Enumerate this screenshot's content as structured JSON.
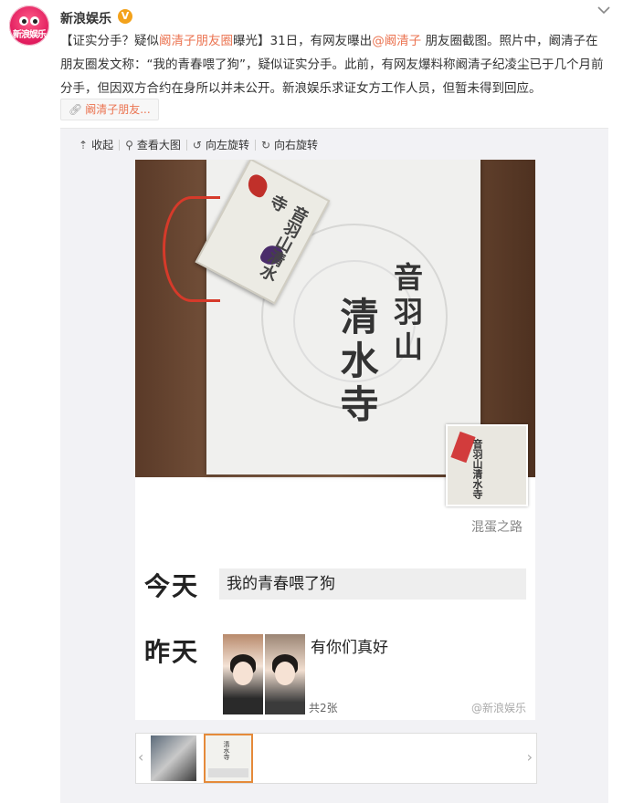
{
  "account": {
    "avatar_text": "新浪娱乐",
    "name": "新浪娱乐",
    "verified_badge": "V",
    "menu_icon": "chevron-down-icon"
  },
  "post": {
    "p1": "【证实分手？疑似",
    "p1_link": "阚清子朋友圈",
    "p2": "曝光】31日，有网友曝出",
    "p2_mention": "@阚清子",
    "p3": " 朋友圈截图。照片中，阚清子在朋友圈发文称：“我的青春喂了狗”，疑似证实分手。此前，有网友爆料称阚清子纪凌尘已于几个月前分手，但因双方合约在身所以并未公开。新浪娱乐求证女方工作人员，但暂未得到回应。",
    "tag": "阚清子朋友..."
  },
  "toolbar": {
    "collapse": "收起",
    "view_large": "查看大图",
    "rotate_left": "向左旋转",
    "rotate_right": "向右旋转"
  },
  "photo": {
    "card_col1": "音羽山",
    "card_col2": "清水寺",
    "charm_text": "音羽山清水寺",
    "thumb_text": "音羽山清水寺",
    "nickname": "混蛋之路",
    "today_label": "今天",
    "today_status": "我的青春喂了狗",
    "yesterday_label": "昨天",
    "yesterday_caption": "有你们真好",
    "pic_count": "共2张",
    "watermark": "@新浪娱乐"
  },
  "strip": {
    "prev": "‹",
    "next": "›"
  }
}
